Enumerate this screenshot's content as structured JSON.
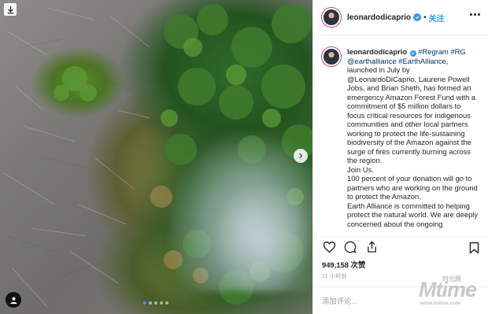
{
  "post": {
    "author": {
      "username": "leonardodicaprio",
      "verified": true,
      "follow_separator": "•",
      "follow_label": "关注"
    },
    "media": {
      "icons": [
        "download-icon",
        "chevron-right-icon",
        "user-tag-icon"
      ],
      "carousel_dot_count": 5,
      "carousel_active_index": 0
    },
    "caption": {
      "username": "leonardodicaprio",
      "parts": [
        "#Regram #RG",
        "@earthalliance #EarthAlliance,",
        "launched in July by",
        "@LeonardoDiCaprio, Laurene Powell Jobs, and Brian Sheth, has formed an emergency Amazon Forest Fund with a commitment of $5 million dollars to focus critical resources for indigenous communities and other local partners working to protect the life-sustaining biodiversity of the Amazon against the surge of fires currently burning across the region.",
        "Join Us.",
        "100 percent of your donation will go to partners who are working on the ground to protect the Amazon.",
        "Earth Alliance is committed to helping protect the natural world. We are deeply concerned about the ongoing"
      ]
    },
    "actions": {
      "icons": [
        "heart-icon",
        "comment-icon",
        "share-icon",
        "bookmark-icon"
      ]
    },
    "likes": "949,158 次赞",
    "time_ago": "11 小时前",
    "comment": {
      "placeholder": "添加评论..."
    },
    "watermark": {
      "main": "Mtime",
      "sub": "时光网",
      "url": "www.mtime.com"
    },
    "colors": {
      "link": "#3897f0",
      "hashtag": "#003569",
      "text": "#262626",
      "muted": "#999999"
    }
  }
}
